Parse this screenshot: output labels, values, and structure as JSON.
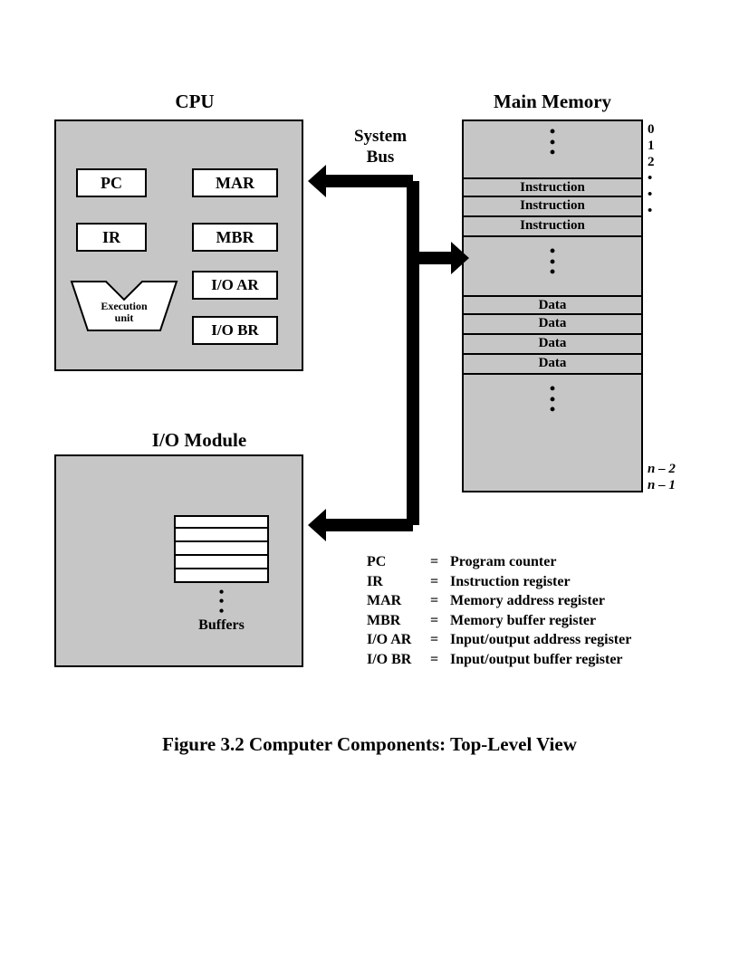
{
  "titles": {
    "cpu": "CPU",
    "memory": "Main Memory",
    "io": "I/O Module",
    "bus_line1": "System",
    "bus_line2": "Bus"
  },
  "cpu": {
    "pc": "PC",
    "mar": "MAR",
    "ir": "IR",
    "mbr": "MBR",
    "ioar": "I/O AR",
    "iobr": "I/O BR",
    "exec_line1": "Execution",
    "exec_line2": "unit"
  },
  "memory": {
    "instr": "Instruction",
    "data": "Data",
    "addr0": "0",
    "addr1": "1",
    "addr2": "2",
    "addr_n2": "n – 2",
    "addr_n1": "n – 1"
  },
  "io": {
    "buffers": "Buffers"
  },
  "legend": [
    {
      "key": "PC",
      "val": "Program counter"
    },
    {
      "key": "IR",
      "val": "Instruction register"
    },
    {
      "key": "MAR",
      "val": "Memory address register"
    },
    {
      "key": "MBR",
      "val": "Memory buffer register"
    },
    {
      "key": "I/O AR",
      "val": "Input/output address register"
    },
    {
      "key": "I/O BR",
      "val": "Input/output buffer register"
    }
  ],
  "caption": "Figure 3.2  Computer Components: Top-Level View"
}
